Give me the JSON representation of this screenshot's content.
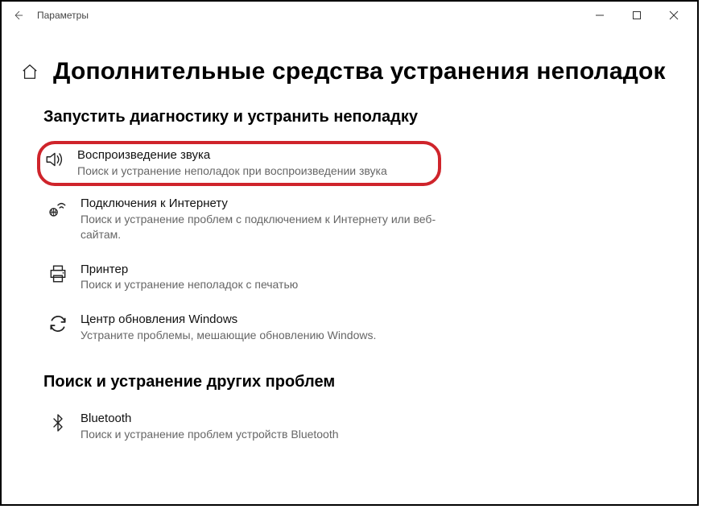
{
  "window": {
    "title": "Параметры"
  },
  "page": {
    "title": "Дополнительные средства устранения неполадок"
  },
  "sections": {
    "primary": {
      "heading": "Запустить диагностику и устранить неполадку",
      "items": [
        {
          "label": "Воспроизведение звука",
          "desc": "Поиск и устранение неполадок при воспроизведении звука"
        },
        {
          "label": "Подключения к Интернету",
          "desc": "Поиск и устранение проблем с подключением к Интернету или веб-сайтам."
        },
        {
          "label": "Принтер",
          "desc": "Поиск и устранение неполадок с печатью"
        },
        {
          "label": "Центр обновления Windows",
          "desc": "Устраните проблемы, мешающие обновлению Windows."
        }
      ]
    },
    "secondary": {
      "heading": "Поиск и устранение других проблем",
      "items": [
        {
          "label": "Bluetooth",
          "desc": "Поиск и устранение проблем устройств Bluetooth"
        }
      ]
    }
  }
}
